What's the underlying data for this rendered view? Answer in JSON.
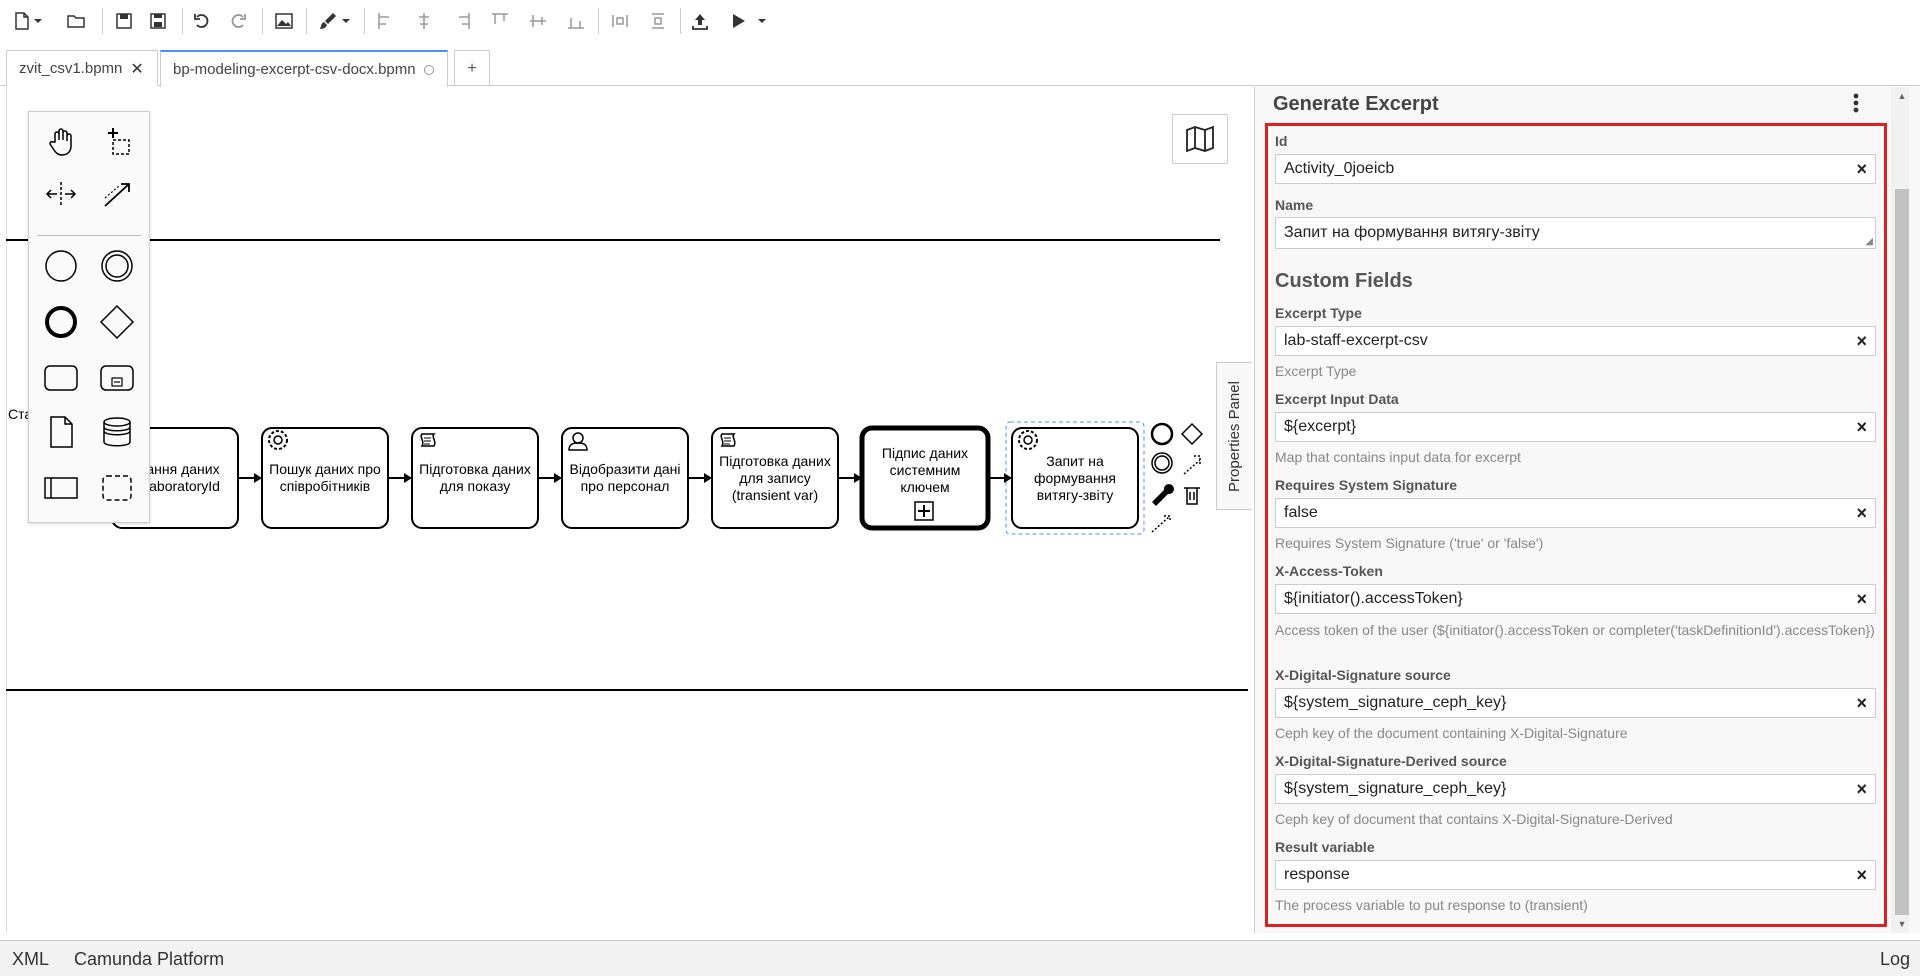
{
  "tabs": [
    {
      "label": "zvit_csv1.bpmn",
      "close": "✕"
    },
    {
      "label": "bp-modeling-excerpt-csv-docx.bpmn"
    }
  ],
  "add_tab": "+",
  "diagram": {
    "lane_label": "Ста",
    "tasks": [
      {
        "label": "ання даних laboratoryId",
        "type": "task"
      },
      {
        "label": "Пошук даних про співробітників",
        "type": "service"
      },
      {
        "label": "Підготовка даних для показу",
        "type": "script"
      },
      {
        "label": "Відобразити дані про персонал",
        "type": "user"
      },
      {
        "label": "Підготовка даних для запису (transient var)",
        "type": "script"
      },
      {
        "label": "Підпис даних системним ключем",
        "type": "call-activity"
      },
      {
        "label": "Запит на формування витягу-звіту",
        "type": "service"
      }
    ]
  },
  "properties_toggle": "Properties Panel",
  "panel": {
    "title": "Generate Excerpt",
    "section_title": "Custom Fields",
    "fields": [
      {
        "label": "Id",
        "value": "Activity_0joeicb",
        "desc": ""
      },
      {
        "label": "Name",
        "value": "Запит на формування витягу-звіту",
        "desc": ""
      },
      {
        "label": "Excerpt Type",
        "value": "lab-staff-excerpt-csv",
        "desc": "Excerpt Type"
      },
      {
        "label": "Excerpt Input Data",
        "value": "${excerpt}",
        "desc": "Map that contains input data for excerpt"
      },
      {
        "label": "Requires System Signature",
        "value": "false",
        "desc": "Requires System Signature ('true' or 'false')"
      },
      {
        "label": "X-Access-Token",
        "value": "${initiator().accessToken}",
        "desc": "Access token of the user (${initiator().accessToken or completer('taskDefinitionId').accessToken})"
      },
      {
        "label": "X-Digital-Signature source",
        "value": "${system_signature_ceph_key}",
        "desc": "Ceph key of the document containing X-Digital-Signature"
      },
      {
        "label": "X-Digital-Signature-Derived source",
        "value": "${system_signature_ceph_key}",
        "desc": "Ceph key of document that contains X-Digital-Signature-Derived"
      },
      {
        "label": "Result variable",
        "value": "response",
        "desc": "The process variable to put response to (transient)"
      }
    ],
    "clear_symbol": "×"
  },
  "status": {
    "xml": "XML",
    "platform": "Camunda Platform",
    "log": "Log"
  },
  "colors": {
    "highlight": "#e02020",
    "tab_active": "#4d90fe",
    "selection": "#4d90fe"
  }
}
